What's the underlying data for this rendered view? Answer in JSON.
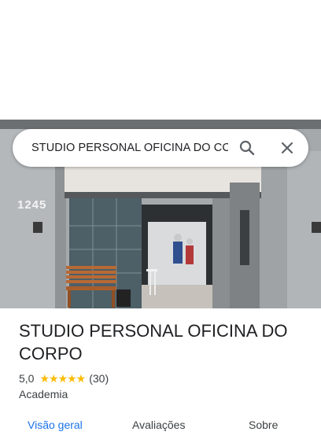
{
  "search": {
    "query": "STUDIO PERSONAL OFICINA DO CC"
  },
  "photo": {
    "house_number": "1245"
  },
  "place": {
    "name": "STUDIO PERSONAL OFICINA DO CORPO",
    "rating": "5,0",
    "stars": "★★★★★",
    "reviews_count": "(30)",
    "category": "Academia"
  },
  "tabs": [
    {
      "label": "Visão geral",
      "active": true
    },
    {
      "label": "Avaliações",
      "active": false
    },
    {
      "label": "Sobre",
      "active": false
    }
  ],
  "colors": {
    "accent": "#1a73e8",
    "star": "#fbbc04",
    "text": "#202124"
  }
}
